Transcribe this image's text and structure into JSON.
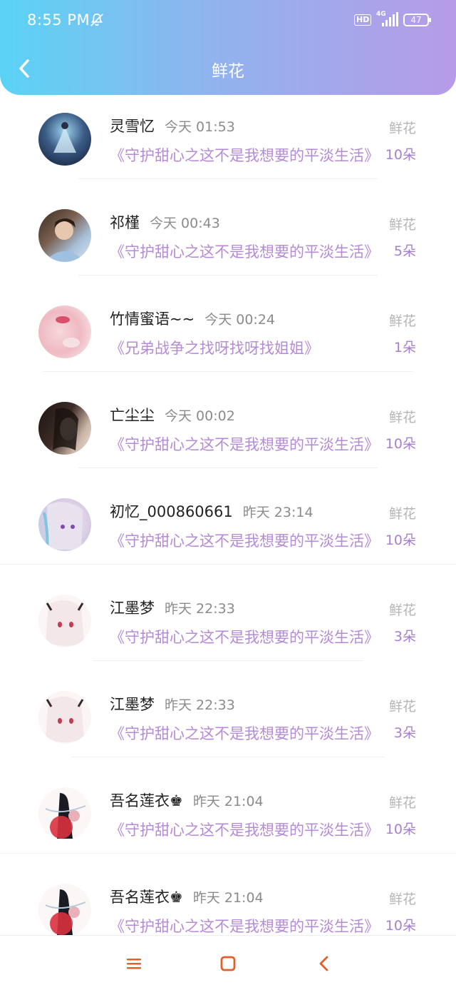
{
  "status_bar": {
    "time": "8:55 PM",
    "icons": [
      "bell-muted-icon",
      "hd-icon",
      "signal-4g-icon",
      "battery-icon"
    ],
    "hd": "HD",
    "network": "4G",
    "battery": "47"
  },
  "header": {
    "title": "鲜花",
    "back_icon": "chevron-left-icon"
  },
  "colors": {
    "header_gradient_start": "#5ad3f4",
    "header_gradient_end": "#b79be8",
    "book_title": "#b58ad6",
    "count": "#a77fd2"
  },
  "items": [
    {
      "name": "灵雪忆",
      "time": "今天 01:53",
      "type": "鲜花",
      "book": "《守护甜心之这不是我想要的平淡生活》",
      "count": "10朵"
    },
    {
      "name": "祁槿",
      "time": "今天 00:43",
      "type": "鲜花",
      "book": "《守护甜心之这不是我想要的平淡生活》",
      "count": "5朵"
    },
    {
      "name": "竹情蜜语~~",
      "time": "今天 00:24",
      "type": "鲜花",
      "book": "《兄弟战争之找呀找呀找姐姐》",
      "count": "1朵"
    },
    {
      "name": "亡尘尘",
      "time": "今天 00:02",
      "type": "鲜花",
      "book": "《守护甜心之这不是我想要的平淡生活》",
      "count": "10朵"
    },
    {
      "name": "初忆_000860661",
      "time": "昨天 23:14",
      "type": "鲜花",
      "book": "《守护甜心之这不是我想要的平淡生活》",
      "count": "10朵"
    },
    {
      "name": "江墨梦",
      "time": "昨天 22:33",
      "type": "鲜花",
      "book": "《守护甜心之这不是我想要的平淡生活》",
      "count": "3朵"
    },
    {
      "name": "江墨梦",
      "time": "昨天 22:33",
      "type": "鲜花",
      "book": "《守护甜心之这不是我想要的平淡生活》",
      "count": "3朵"
    },
    {
      "name": "吾名莲衣♚",
      "time": "昨天 21:04",
      "type": "鲜花",
      "book": "《守护甜心之这不是我想要的平淡生活》",
      "count": "10朵"
    },
    {
      "name": "吾名莲衣♚",
      "time": "昨天 21:04",
      "type": "鲜花",
      "book": "《守护甜心之这不是我想要的平淡生活》",
      "count": "10朵"
    }
  ],
  "nav": {
    "icons": [
      "menu-icon",
      "home-square-icon",
      "back-triangle-icon"
    ]
  }
}
